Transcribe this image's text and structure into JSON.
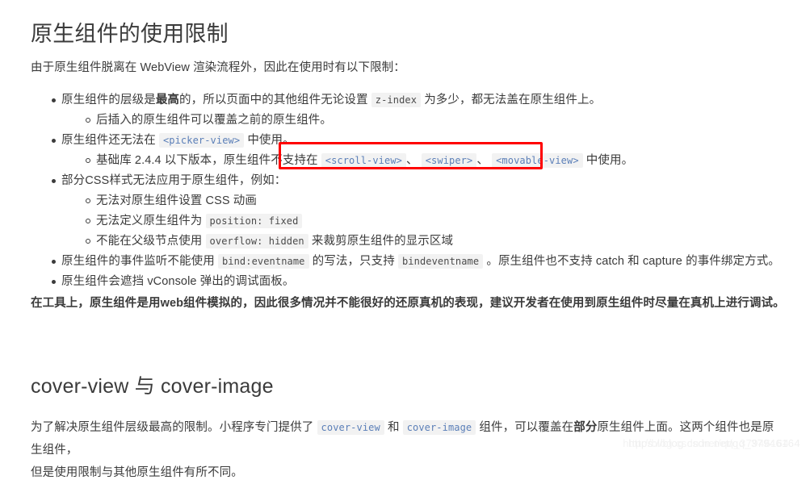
{
  "document": {
    "title": "原生组件的使用限制",
    "intro": "由于原生组件脱离在 WebView 渲染流程外，因此在使用时有以下限制：",
    "bullets": {
      "b1_a": "原生组件的层级是",
      "b1_bold": "最高",
      "b1_b": "的，所以页面中的其他组件无论设置",
      "b1_code": "z-index",
      "b1_c": "为多少，都无法盖在原生组件上。",
      "b1_sub1": "后插入的原生组件可以覆盖之前的原生组件。",
      "b2_a": "原生组件还无法在",
      "b2_code": "<picker-view>",
      "b2_b": "中使用。",
      "b2_sub1_a": "基础库 2.4.4 以下版本，原生组件不支持在",
      "b2_sub1_code1": "<scroll-view>",
      "b2_sub1_sep1": "、",
      "b2_sub1_code2": "<swiper>",
      "b2_sub1_sep2": "、",
      "b2_sub1_code3": "<movable-view>",
      "b2_sub1_b": "中使用。",
      "b3_a": "部分CSS样式无法应用于原生组件，例如：",
      "b3_sub1": "无法对原生组件设置 CSS 动画",
      "b3_sub2_a": "无法定义原生组件为",
      "b3_sub2_code": "position: fixed",
      "b3_sub3_a": "不能在父级节点使用",
      "b3_sub3_code": "overflow: hidden",
      "b3_sub3_b": "来裁剪原生组件的显示区域",
      "b4_a": "原生组件的事件监听不能使用",
      "b4_code1": "bind:eventname",
      "b4_b": "的写法，只支持",
      "b4_code2": "bindeventname",
      "b4_c": "。原生组件也不支持 catch 和 capture 的事件绑定方式。",
      "b5": "原生组件会遮挡 vConsole 弹出的调试面板。"
    },
    "bold_note_a": "在工具上，原生组件是用",
    "bold_note_bold": "web",
    "bold_note_b": "组件模拟的，因此很多情况并不能很好的还原真机的表现，建议开发者在使用到原生组件时尽量在真机上进行调试。",
    "section2": {
      "title": "cover-view 与 cover-image",
      "p1_a": "为了解决原生组件层级最高的限制。小程序专门提供了",
      "p1_code1": "cover-view",
      "p1_b": "和",
      "p1_code2": "cover-image",
      "p1_c": "组件，可以覆盖在",
      "p1_bold": "部分",
      "p1_d": "原生组件上面。这两个组件也是原生组件，",
      "p2": "但是使用限制与其他原生组件有所不同。"
    },
    "watermark": "https://blog.csdn.net/qq_37946164",
    "watermark2": "http://blog.csdn.net/qq_37946164",
    "colors": {
      "highlight_box": "#ff0000",
      "code_tag": "#5b7fb8",
      "text": "#3b3b3b",
      "code_bg": "#f2f2f2"
    }
  }
}
